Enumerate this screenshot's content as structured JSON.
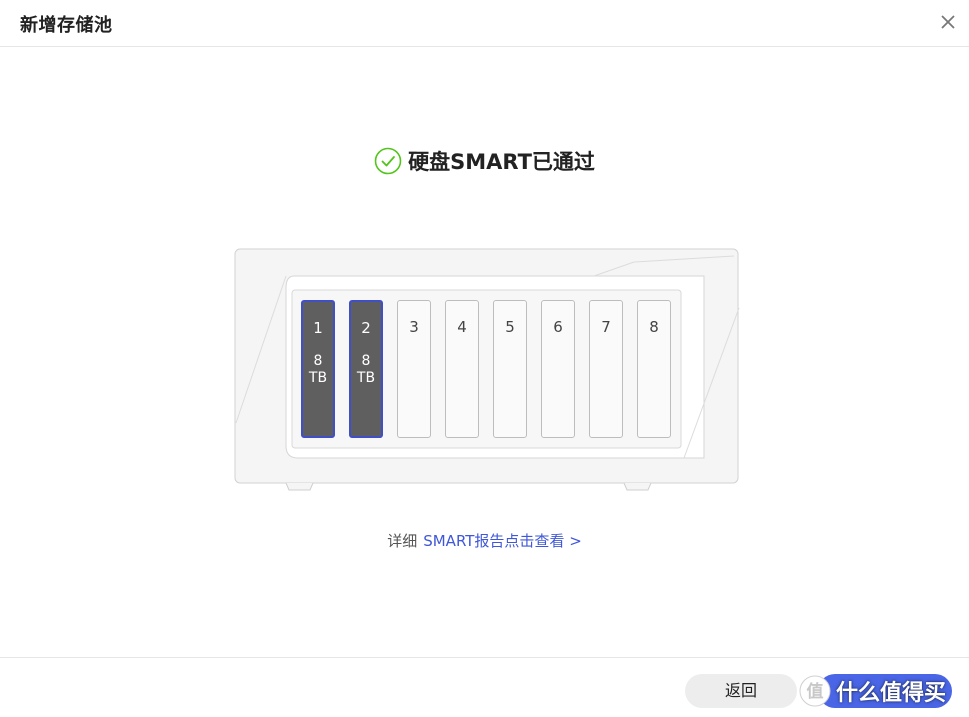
{
  "dialog": {
    "title": "新增存储池"
  },
  "status": {
    "text": "硬盘SMART已通过",
    "color": "#52c41a"
  },
  "bays": [
    {
      "slot": "1",
      "capacity": "8",
      "unit": "TB",
      "filled": true
    },
    {
      "slot": "2",
      "capacity": "8",
      "unit": "TB",
      "filled": true
    },
    {
      "slot": "3",
      "capacity": "",
      "unit": "",
      "filled": false
    },
    {
      "slot": "4",
      "capacity": "",
      "unit": "",
      "filled": false
    },
    {
      "slot": "5",
      "capacity": "",
      "unit": "",
      "filled": false
    },
    {
      "slot": "6",
      "capacity": "",
      "unit": "",
      "filled": false
    },
    {
      "slot": "7",
      "capacity": "",
      "unit": "",
      "filled": false
    },
    {
      "slot": "8",
      "capacity": "",
      "unit": "",
      "filled": false
    }
  ],
  "report": {
    "prefix": "详细",
    "link": "SMART报告点击查看 >"
  },
  "footer": {
    "back_label": "返回"
  },
  "watermark": {
    "text": "什么值得买"
  },
  "colors": {
    "accent": "#3f57d8",
    "filled_bay": "#5f5f5f",
    "filled_bay_border": "#3f4fc8"
  }
}
